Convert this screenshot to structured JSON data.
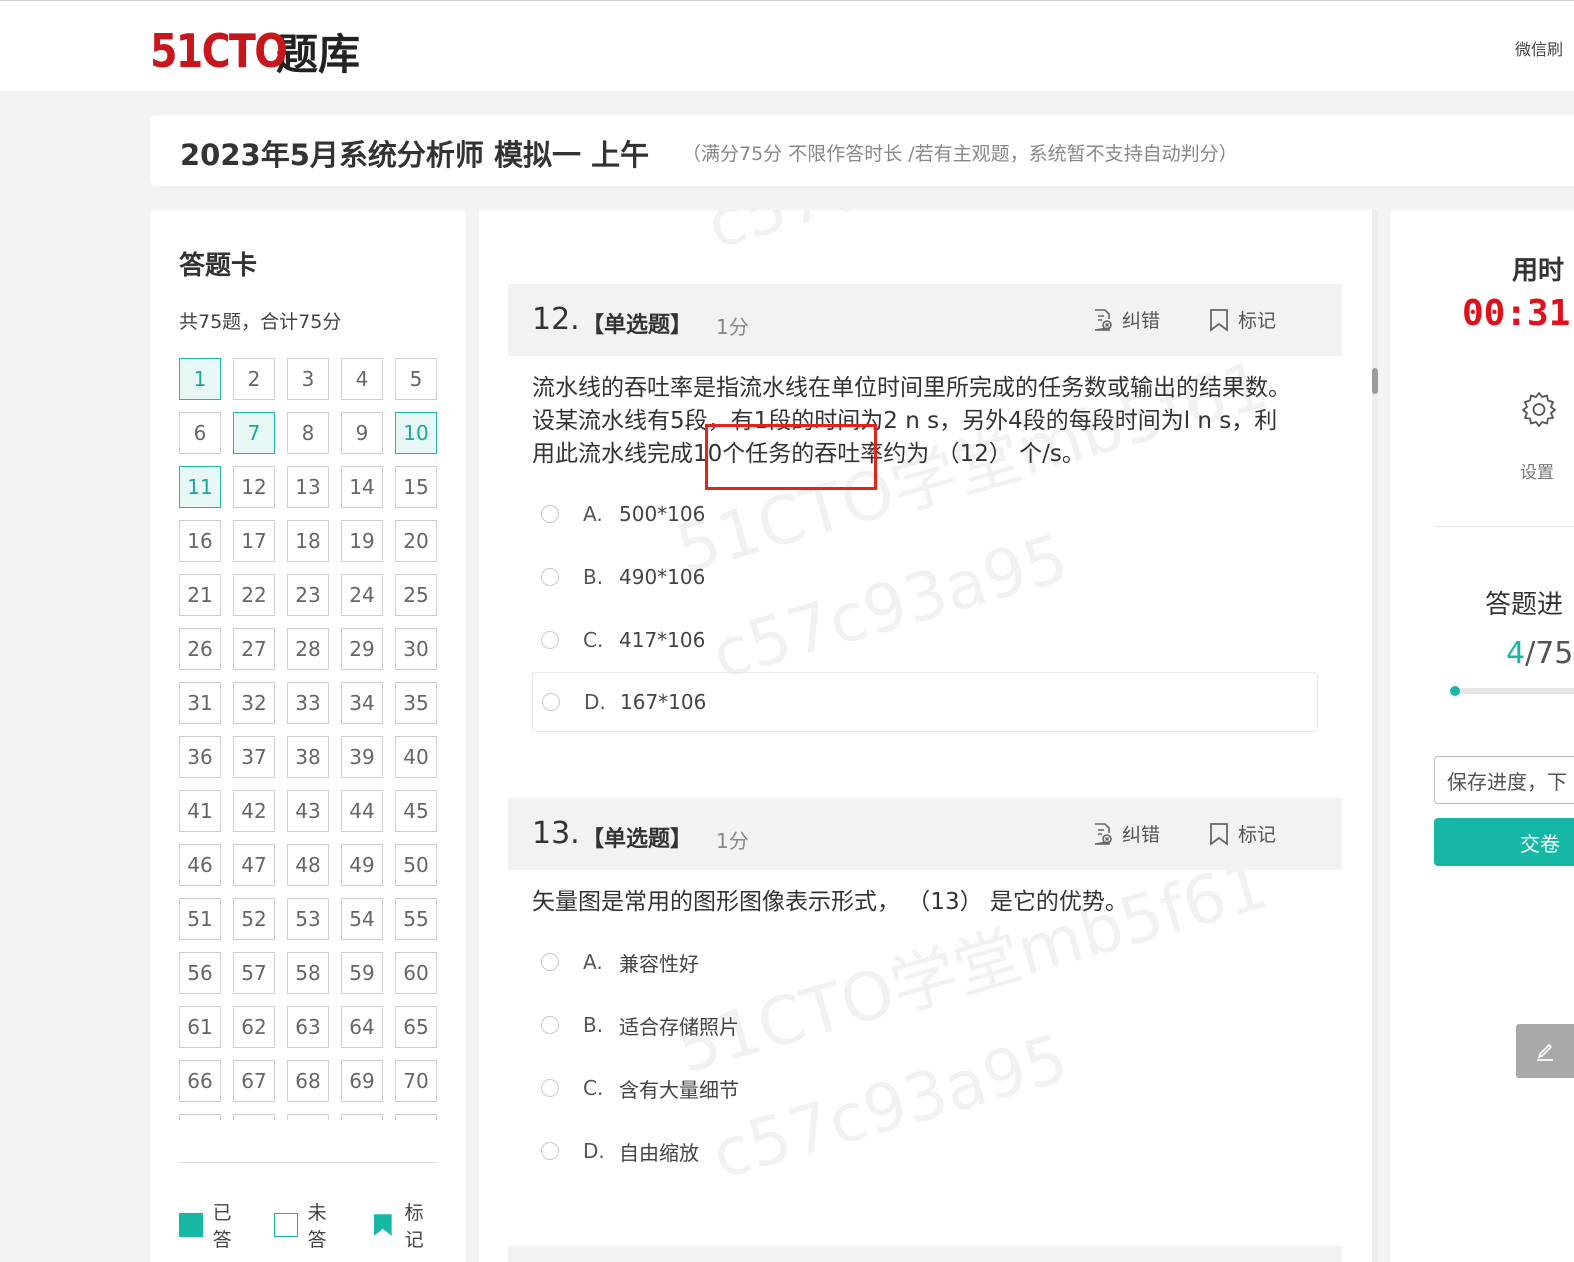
{
  "header": {
    "logo_number": "51CTO",
    "logo_text": "题库",
    "wechat_link": "微信刷"
  },
  "exam": {
    "title": "2023年5月系统分析师 模拟一 上午",
    "subtitle": "（满分75分 不限作答时长 /若有主观题，系统暂不支持自动判分）"
  },
  "answer_card": {
    "title": "答题卡",
    "summary": "共75题，合计75分",
    "answered": [
      1,
      7,
      10,
      11
    ],
    "legend": {
      "answered": "已答",
      "unanswered": "未答",
      "marked": "标记"
    }
  },
  "questions": [
    {
      "number": "12.",
      "type": "【单选题】",
      "score": "1分",
      "stem": "流水线的吞吐率是指流水线在单位时间里所完成的任务数或输出的结果数。设某流水线有5段，有1段的时间为2 n s，另外4段的每段时间为l n s，利用此流水线完成10个任务的吞吐率约为 （12） 个/s。",
      "options": [
        {
          "letter": "A.",
          "text": "500*106"
        },
        {
          "letter": "B.",
          "text": "490*106"
        },
        {
          "letter": "C.",
          "text": "417*106"
        },
        {
          "letter": "D.",
          "text": "167*106"
        }
      ]
    },
    {
      "number": "13.",
      "type": "【单选题】",
      "score": "1分",
      "stem": "矢量图是常用的图形图像表示形式， （13） 是它的优势。",
      "options": [
        {
          "letter": "A.",
          "text": "兼容性好"
        },
        {
          "letter": "B.",
          "text": "适合存储照片"
        },
        {
          "letter": "C.",
          "text": "含有大量细节"
        },
        {
          "letter": "D.",
          "text": "自由缩放"
        }
      ]
    }
  ],
  "question_actions": {
    "report": "纠错",
    "mark": "标记"
  },
  "watermark": {
    "brand": "51CTO学堂mb5f61",
    "code": "c57c93a95"
  },
  "side_panel": {
    "time_label": "用时",
    "time_value": "00:31:",
    "settings_label": "设置",
    "progress_label": "答题进",
    "progress_done": "4",
    "progress_total": "/75",
    "progress_fraction": 0.053,
    "save_button": "保存进度，下",
    "submit_button": "交卷"
  },
  "colors": {
    "brand_red": "#c8161d",
    "accent_teal": "#16b8a5",
    "timer_red": "#e0101a"
  }
}
